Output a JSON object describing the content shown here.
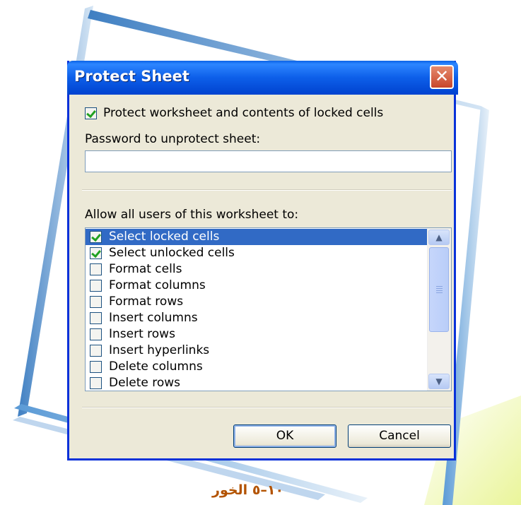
{
  "dialog": {
    "title": "Protect Sheet",
    "close_glyph": "✕",
    "protect_checkbox": {
      "label": "Protect worksheet and contents of locked cells",
      "checked": true
    },
    "password_label": "Password to unprotect sheet:",
    "password_value": "",
    "allow_label": "Allow all users of this worksheet to:",
    "permissions": [
      {
        "label": "Select locked cells",
        "checked": true,
        "selected": true
      },
      {
        "label": "Select unlocked cells",
        "checked": true,
        "selected": false
      },
      {
        "label": "Format cells",
        "checked": false,
        "selected": false
      },
      {
        "label": "Format columns",
        "checked": false,
        "selected": false
      },
      {
        "label": "Format rows",
        "checked": false,
        "selected": false
      },
      {
        "label": "Insert columns",
        "checked": false,
        "selected": false
      },
      {
        "label": "Insert rows",
        "checked": false,
        "selected": false
      },
      {
        "label": "Insert hyperlinks",
        "checked": false,
        "selected": false
      },
      {
        "label": "Delete columns",
        "checked": false,
        "selected": false
      },
      {
        "label": "Delete rows",
        "checked": false,
        "selected": false
      }
    ],
    "ok_label": "OK",
    "cancel_label": "Cancel"
  },
  "caption": "١٠–٥ الخور",
  "colors": {
    "titlebar": "#0a5ce6",
    "selection": "#316ac5",
    "accent_frame": "#4a86c5",
    "caption": "#b35300"
  }
}
